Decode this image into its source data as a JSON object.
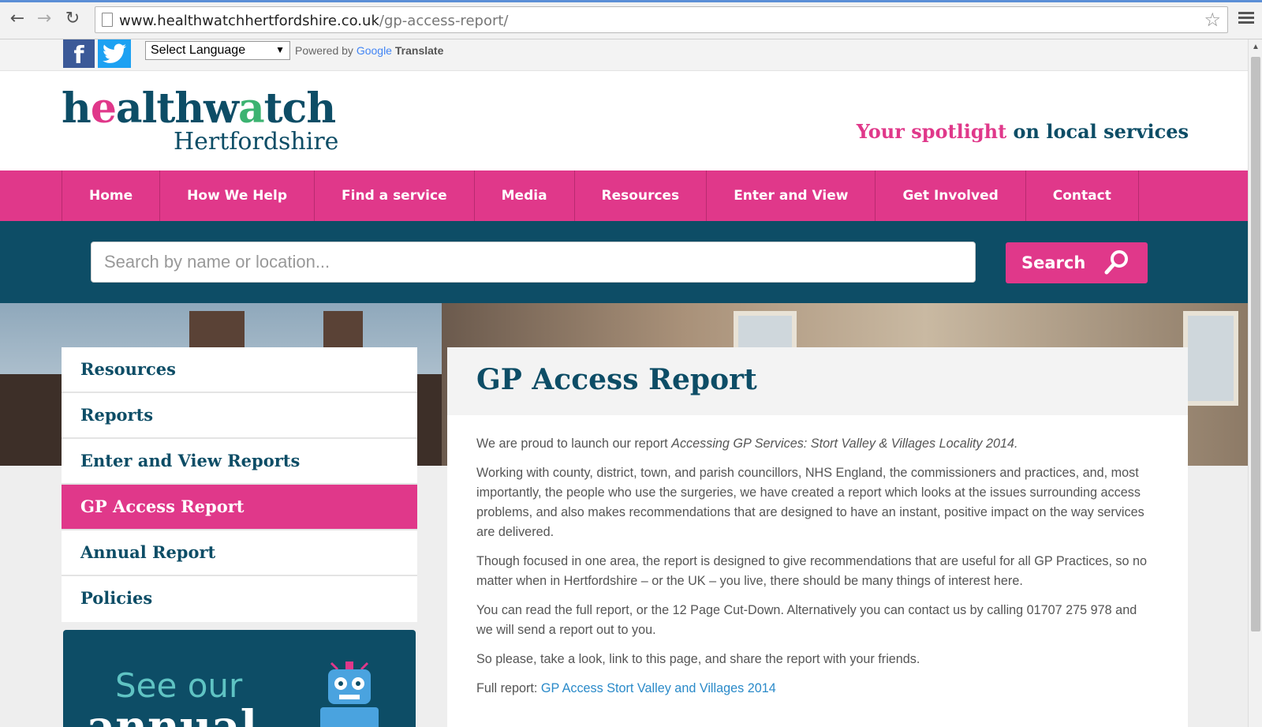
{
  "browser": {
    "url_domain": "www.healthwatchhertfordshire.co.uk",
    "url_path": "/gp-access-report/"
  },
  "translate": {
    "select_label": "Select Language",
    "powered_by": "Powered by",
    "google": "Google",
    "translate": "Translate"
  },
  "social": {
    "facebook": "f",
    "twitter": "t"
  },
  "header": {
    "logo_word_a": "h",
    "logo_word_b": "e",
    "logo_word_c": "althw",
    "logo_word_d": "a",
    "logo_word_e": "tch",
    "logo_sub": "Hertfordshire",
    "tagline_pink": "Your spotlight",
    "tagline_rest": " on local services"
  },
  "nav": {
    "items": [
      "Home",
      "How We Help",
      "Find a service",
      "Media",
      "Resources",
      "Enter and View",
      "Get Involved",
      "Contact"
    ]
  },
  "search": {
    "placeholder": "Search by name or location...",
    "button_label": "Search"
  },
  "sidebar": {
    "items": [
      "Resources",
      "Reports",
      "Enter and View Reports",
      "GP Access Report",
      "Annual Report",
      "Policies"
    ],
    "active": "GP Access Report"
  },
  "promo": {
    "line1": "See our",
    "line2": "annual"
  },
  "content": {
    "title": "GP Access Report",
    "p1_pre": "We are proud to launch our report ",
    "p1_em": "Accessing GP Services: Stort Valley & Villages Locality 2014.",
    "p2": "Working with county, district, town, and parish councillors, NHS England, the commissioners and practices, and, most importantly, the people who use the surgeries, we have created a report which looks at the issues surrounding access problems, and also makes recommendations that are designed to have an instant, positive impact on the way services are delivered.",
    "p3": "Though focused in one area, the report is designed to give recommendations that are useful for all GP Practices, so no matter when in Hertfordshire – or the UK – you live, there should be many things of interest here.",
    "p4": "You can read the full report, or the 12 Page Cut-Down. Alternatively you can contact us by calling 01707 275 978 and we will send a report out to you.",
    "p5": "So please, take a look, link to this page, and share the report with your friends.",
    "full_report_label": "Full report: ",
    "full_report_link": "GP Access Stort Valley and Villages 2014"
  },
  "colors": {
    "pink": "#e0388a",
    "navy": "#0d4d66",
    "link": "#2a8ac9"
  }
}
